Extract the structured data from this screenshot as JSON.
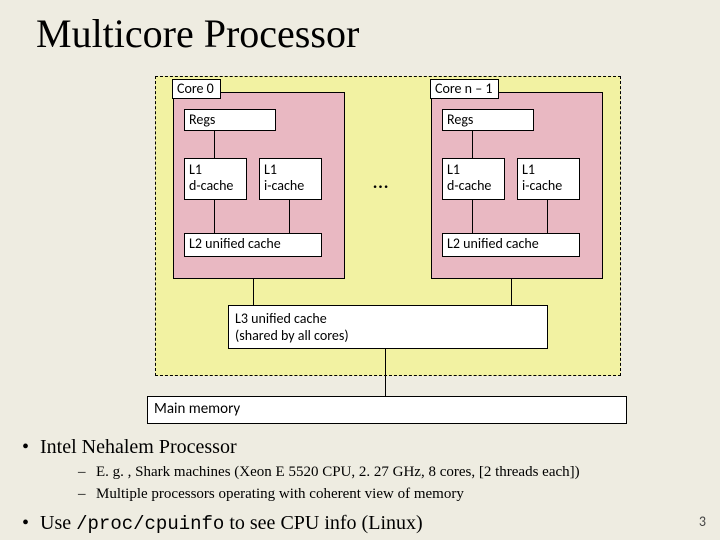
{
  "title": "Multicore Processor",
  "core0": {
    "label": "Core 0",
    "regs": "Regs",
    "l1d": "L1\nd-cache",
    "l1i": "L1\ni-cache",
    "l2": "L2 unified cache"
  },
  "core1": {
    "label": "Core n – 1",
    "regs": "Regs",
    "l1d": "L1\nd-cache",
    "l1i": "L1\ni-cache",
    "l2": "L2 unified cache"
  },
  "ellipsis": "…",
  "l3": "L3 unified cache\n(shared by all cores)",
  "mainmem": "Main memory",
  "bullets": {
    "b1": "Intel Nehalem Processor",
    "b1s1": "E. g. , Shark machines (Xeon E 5520 CPU, 2. 27 GHz, 8 cores, [2 threads each])",
    "b1s2": "Multiple processors operating with coherent view of memory",
    "b2_pre": "Use ",
    "b2_code": "/proc/cpuinfo",
    "b2_post": " to see CPU info (Linux)"
  },
  "pagenum": "3"
}
